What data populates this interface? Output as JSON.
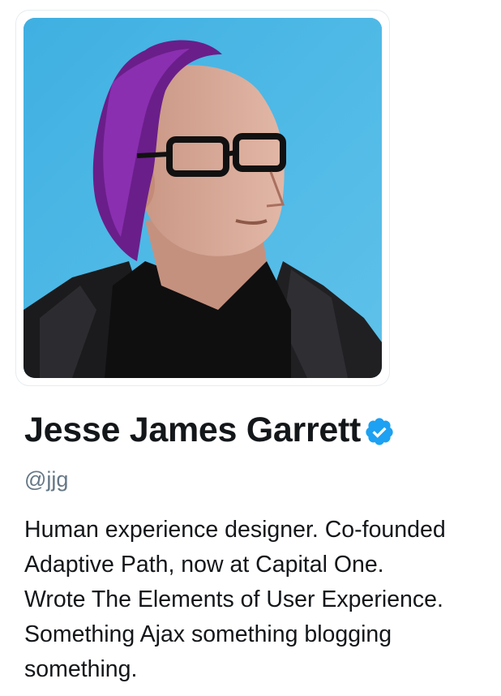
{
  "profile": {
    "name": "Jesse James Garrett",
    "handle": "@jjg",
    "verified": true,
    "avatar_icon": "profile-photo",
    "bio_lines": [
      "Human experience designer. Co-founded",
      "Adaptive Path, now at Capital One.",
      "Wrote The Elements of User Experience.",
      "Something Ajax something blogging",
      "something."
    ]
  },
  "colors": {
    "verified_badge": "#1da1f2",
    "name_text": "#14171a",
    "handle_text": "#657786",
    "avatar_background": "#4fb8e6"
  }
}
